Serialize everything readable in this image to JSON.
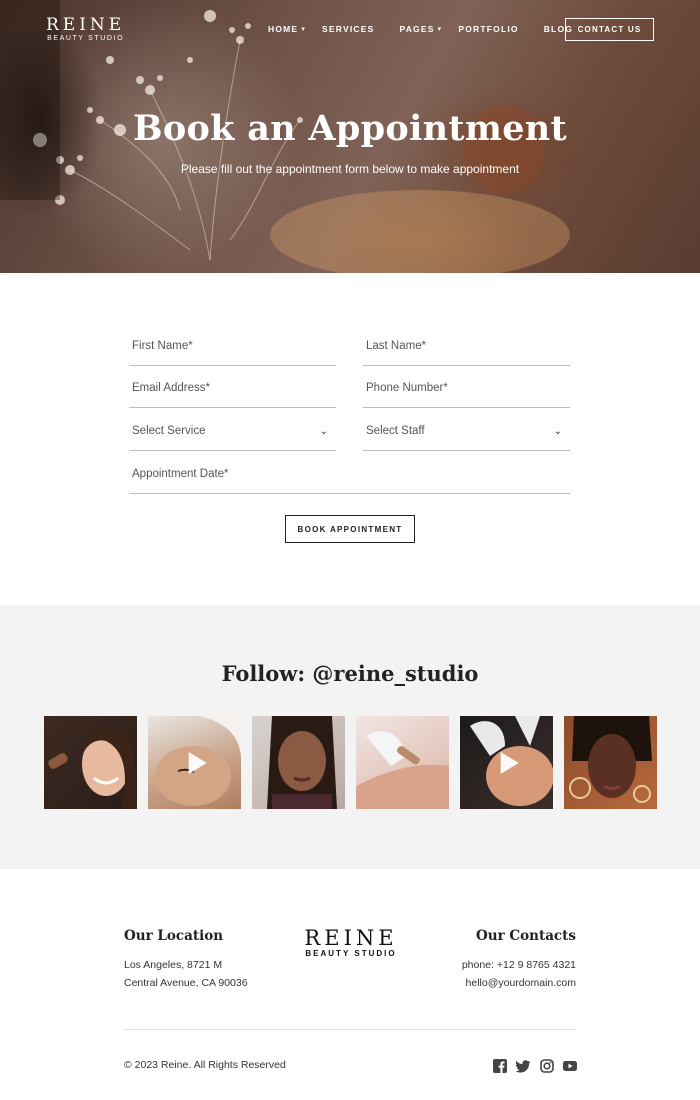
{
  "brand": {
    "name": "REINE",
    "tagline": "BEAUTY STUDIO"
  },
  "nav": {
    "items": [
      {
        "label": "HOME",
        "has_dropdown": true
      },
      {
        "label": "SERVICES",
        "has_dropdown": false
      },
      {
        "label": "PAGES",
        "has_dropdown": true
      },
      {
        "label": "PORTFOLIO",
        "has_dropdown": false
      },
      {
        "label": "BLOG",
        "has_dropdown": false
      }
    ],
    "cta": "CONTACT US",
    "dropdown_glyph": "▾"
  },
  "hero": {
    "title": "Book an Appointment",
    "subtitle": "Please fill out the appointment form below to make appointment"
  },
  "form": {
    "first_name": "First Name*",
    "last_name": "Last Name*",
    "email": "Email Address*",
    "phone": "Phone Number*",
    "service": "Select Service",
    "staff": "Select Staff",
    "date": "Appointment Date*",
    "submit": "BOOK APPOINTMENT",
    "select_glyph": "⌄"
  },
  "instagram": {
    "title": "Follow: @reine_studio",
    "posts": [
      {
        "name": "post-1",
        "video": false
      },
      {
        "name": "post-2",
        "video": true
      },
      {
        "name": "post-3",
        "video": false
      },
      {
        "name": "post-4",
        "video": false
      },
      {
        "name": "post-5",
        "video": true
      },
      {
        "name": "post-6",
        "video": false
      }
    ]
  },
  "footer": {
    "location_title": "Our Location",
    "address_line1": "Los Angeles, 8721 M",
    "address_line2": "Central Avenue, CA 90036",
    "contacts_title": "Our Contacts",
    "phone": "phone: +12 9 8765 4321",
    "email": "hello@yourdomain.com",
    "copyright": "© 2023 Reine. All Rights Reserved",
    "social": [
      "facebook-icon",
      "twitter-icon",
      "instagram-icon",
      "youtube-icon"
    ]
  },
  "colors": {
    "text_dark": "#222222",
    "divider": "#bdbdbd",
    "section_bg": "#f3f3f3"
  }
}
